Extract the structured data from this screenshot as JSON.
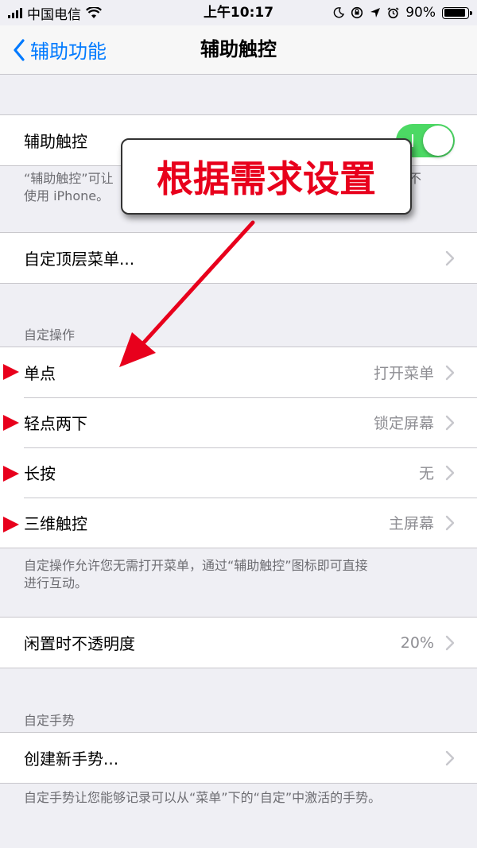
{
  "status_bar": {
    "carrier": "中国电信",
    "time": "上午10:17",
    "battery": "90%",
    "battery_level": 0.9
  },
  "nav": {
    "back_label": "辅助功能",
    "title": "辅助触控"
  },
  "assistive_touch": {
    "label": "辅助触控",
    "enabled": true,
    "footer_line1": "“辅助触控”可让",
    "footer_line1_end": "不",
    "footer_line2": "使用 iPhone。"
  },
  "top_menu": {
    "label": "自定顶层菜单..."
  },
  "custom_actions": {
    "header": "自定操作",
    "rows": [
      {
        "label": "单点",
        "value": "打开菜单"
      },
      {
        "label": "轻点两下",
        "value": "锁定屏幕"
      },
      {
        "label": "长按",
        "value": "无"
      },
      {
        "label": "三维触控",
        "value": "主屏幕"
      }
    ],
    "footer_line1": "自定操作允许您无需打开菜单，通过“辅助触控”图标即可直接",
    "footer_line2": "进行互动。"
  },
  "idle_opacity": {
    "label": "闲置时不透明度",
    "value": "20%"
  },
  "custom_gestures": {
    "header": "自定手势",
    "create_label": "创建新手势...",
    "footer": "自定手势让您能够记录可以从“菜单”下的“自定”中激活的手势。"
  },
  "annotation": {
    "callout_text": "根据需求设置",
    "accent_color": "#e8001c"
  },
  "colors": {
    "ios_blue": "#007aff",
    "toggle_green": "#4cd964",
    "background": "#efeff4"
  }
}
